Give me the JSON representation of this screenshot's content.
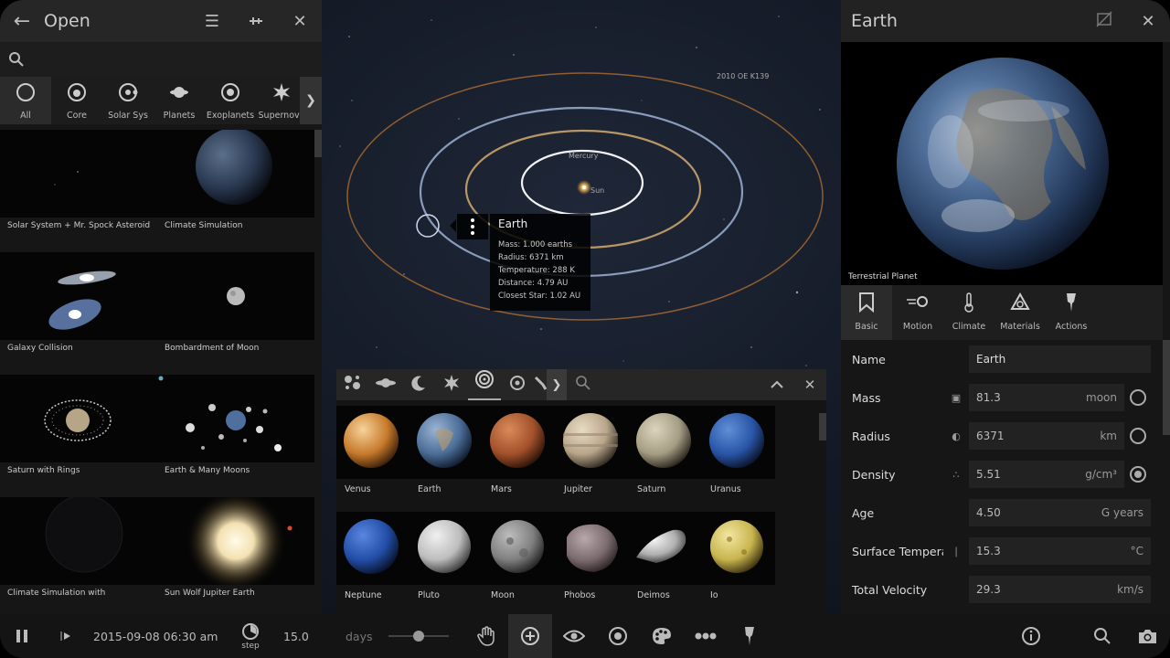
{
  "left_panel": {
    "title": "Open",
    "categories": [
      {
        "label": "All",
        "icon": "circle-icon"
      },
      {
        "label": "Core",
        "icon": "core-icon"
      },
      {
        "label": "Solar Sys",
        "icon": "solar-system-icon"
      },
      {
        "label": "Planets",
        "icon": "planet-icon"
      },
      {
        "label": "Exoplanets",
        "icon": "exoplanet-icon"
      },
      {
        "label": "Supernova",
        "icon": "supernova-icon"
      }
    ],
    "simulations": [
      "Solar System + Mr. Spock Asteroid",
      "Climate Simulation",
      "Galaxy Collision",
      "Bombardment of Moon",
      "Saturn with Rings",
      "Earth & Many Moons",
      "Climate Simulation with",
      "Sun Wolf Jupiter Earth"
    ]
  },
  "space": {
    "labels": {
      "asteroid": "2010 OE K139",
      "mercury": "Mercury",
      "sun": "Sun"
    },
    "tooltip": {
      "title": "Earth",
      "lines": [
        "Mass: 1.000 earths",
        "Radius: 6371 km",
        "Temperature: 288 K",
        "Distance: 4.79 AU",
        "Closest Star: 1.02 AU"
      ]
    }
  },
  "browser": {
    "objects": [
      "Venus",
      "Earth",
      "Mars",
      "Jupiter",
      "Saturn",
      "Uranus",
      "Neptune",
      "Pluto",
      "Moon",
      "Phobos",
      "Deimos",
      "Io"
    ]
  },
  "right_panel": {
    "title": "Earth",
    "planet_type": "Terrestrial Planet",
    "tabs": [
      "Basic",
      "Motion",
      "Climate",
      "Materials",
      "Actions"
    ],
    "properties": [
      {
        "name": "Name",
        "value": "Earth",
        "unit": ""
      },
      {
        "name": "Mass",
        "value": "81.3",
        "unit": "moon"
      },
      {
        "name": "Radius",
        "value": "6371",
        "unit": "km"
      },
      {
        "name": "Density",
        "value": "5.51",
        "unit": "g/cm³"
      },
      {
        "name": "Age",
        "value": "4.50",
        "unit": "G years"
      },
      {
        "name": "Surface Temperatu...",
        "value": "15.3",
        "unit": "°C"
      },
      {
        "name": "Total Velocity",
        "value": "29.3",
        "unit": "km/s"
      }
    ]
  },
  "bottom_bar": {
    "datetime": "2015-09-08 06:30 am",
    "step_label": "step",
    "step_value": "15.0",
    "step_unit": "days",
    "speed_slider_level": 0.5
  },
  "colors": {
    "panel_bg": "#161616",
    "header_bg": "#262626",
    "orbit_earth": "#9fb2d6",
    "orbit_venus": "#c9a46a",
    "orbit_mercury": "#ffffff",
    "orbit_mars": "#b87333"
  }
}
